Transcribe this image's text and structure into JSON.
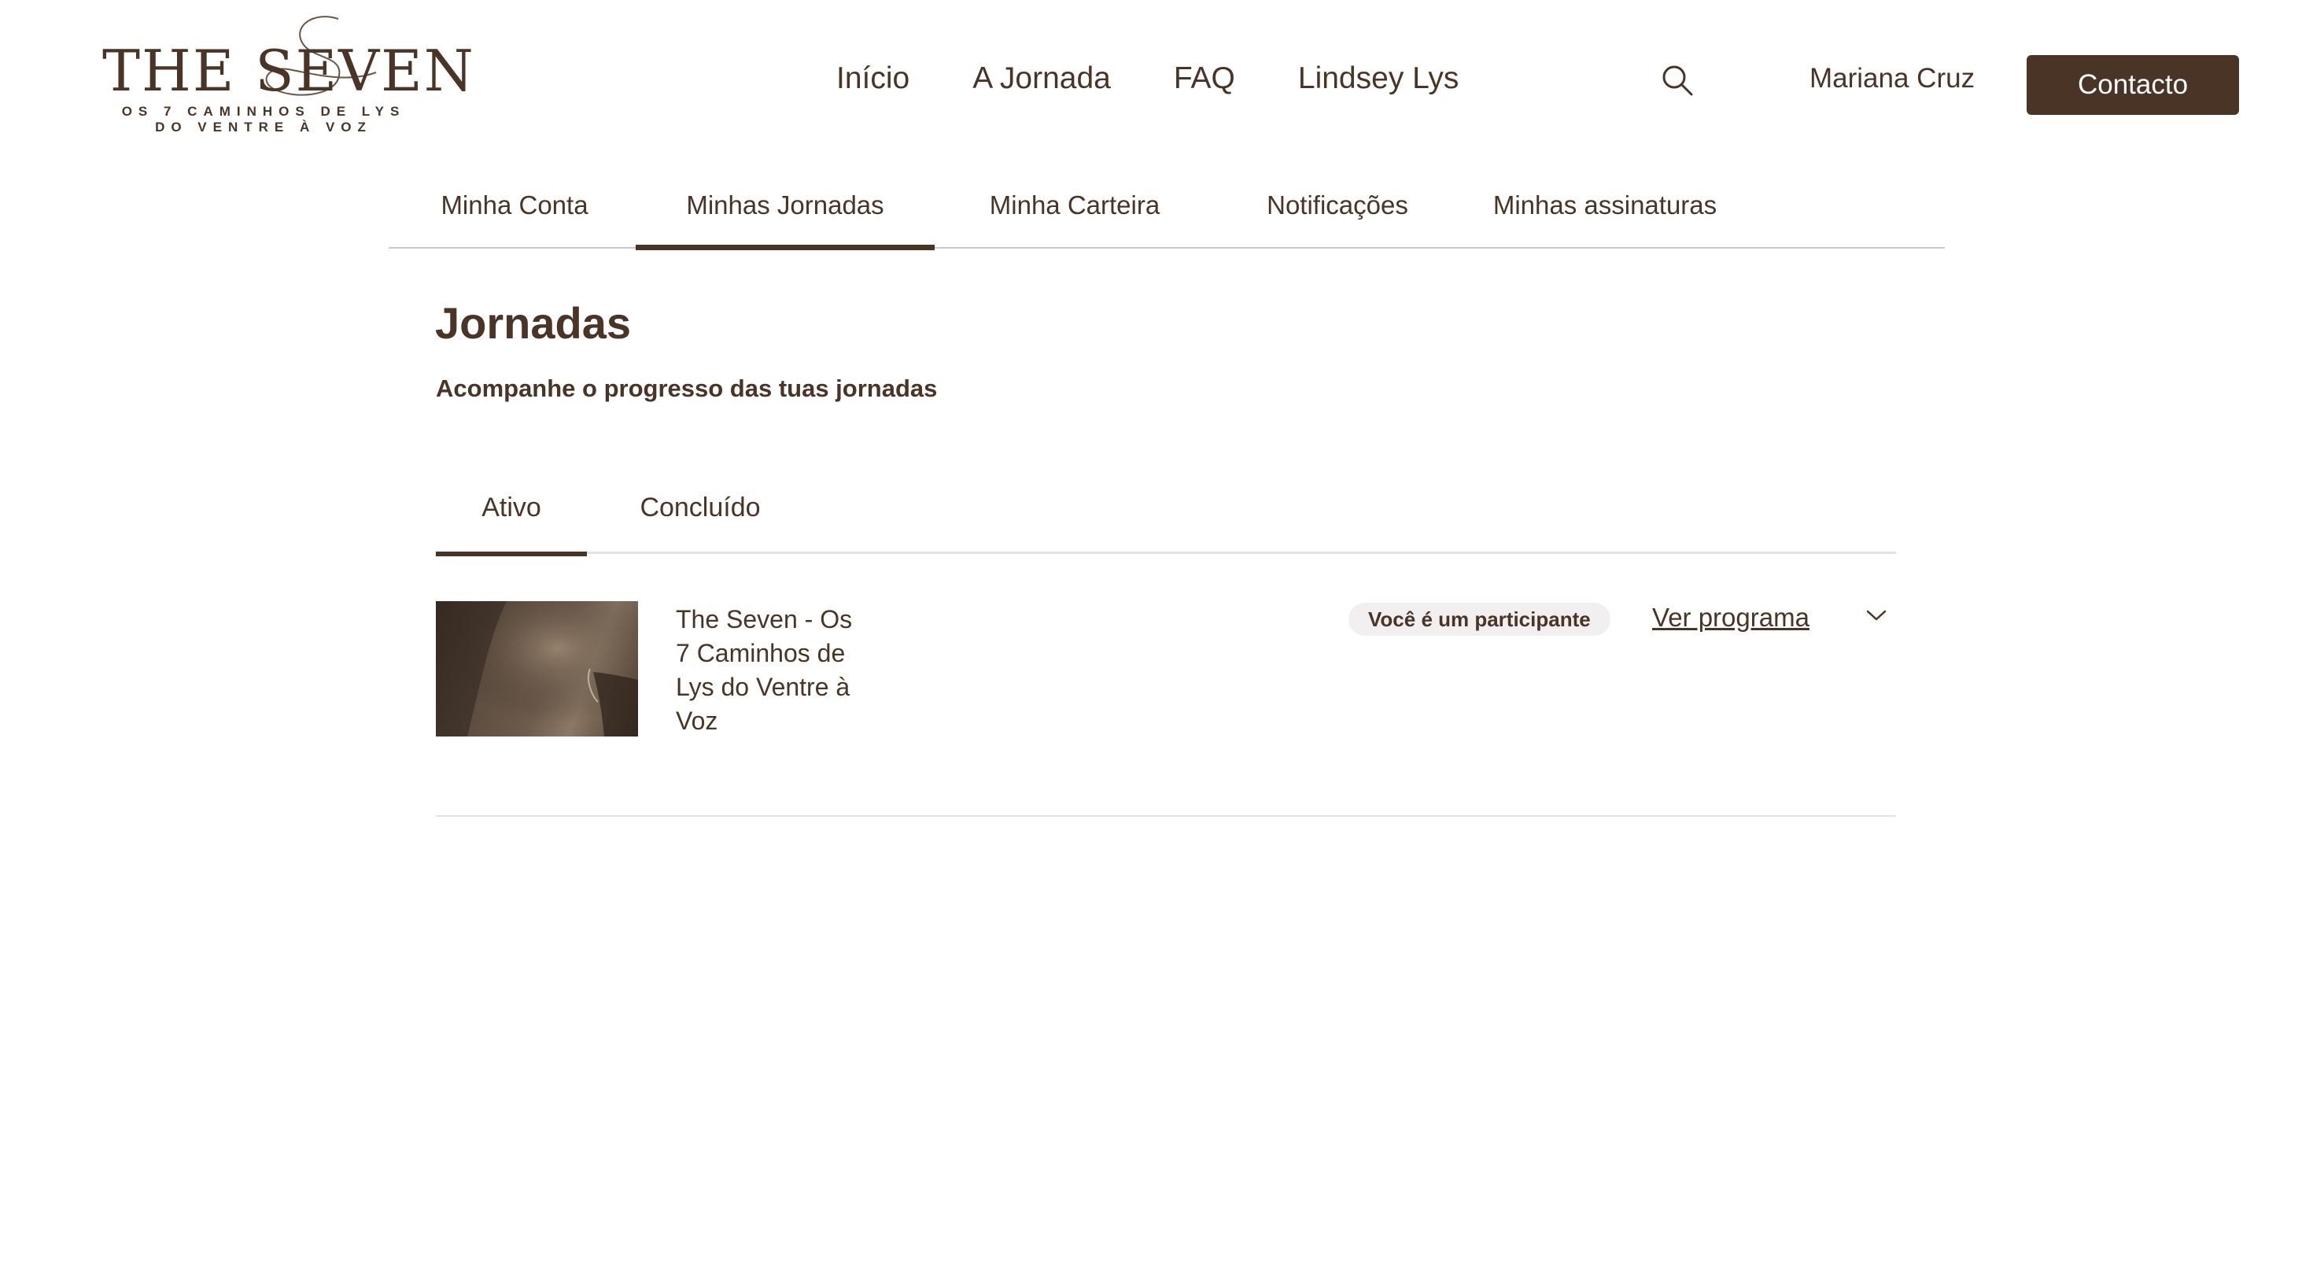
{
  "header": {
    "logo": {
      "title": "THE SEVEN",
      "subtitle_line1": "OS 7 CAMINHOS DE LYS",
      "subtitle_line2": "DO VENTRE À VOZ"
    },
    "nav": [
      {
        "label": "Início"
      },
      {
        "label": "A Jornada"
      },
      {
        "label": "FAQ"
      },
      {
        "label": "Lindsey Lys"
      }
    ],
    "search_icon": "search-icon",
    "user_name": "Mariana Cruz",
    "contact_label": "Contacto"
  },
  "account_tabs": [
    {
      "label": "Minha Conta",
      "active": false
    },
    {
      "label": "Minhas Jornadas",
      "active": true
    },
    {
      "label": "Minha Carteira",
      "active": false
    },
    {
      "label": "Notificações",
      "active": false
    },
    {
      "label": "Minhas assinaturas",
      "active": false
    }
  ],
  "page": {
    "title": "Jornadas",
    "subtitle": "Acompanhe o progresso das tuas jornadas"
  },
  "status_tabs": [
    {
      "label": "Ativo",
      "active": true
    },
    {
      "label": "Concluído",
      "active": false
    }
  ],
  "journeys": [
    {
      "title": "The Seven - Os 7 Caminhos de Lys do Ventre à Voz",
      "badge": "Você é um participante",
      "link_label": "Ver programa",
      "expand_icon": "chevron-down-icon"
    }
  ],
  "colors": {
    "brand": "#4a3426",
    "divider": "#c9c6d6",
    "badge_bg": "#f1efef",
    "background": "#ffffff"
  }
}
